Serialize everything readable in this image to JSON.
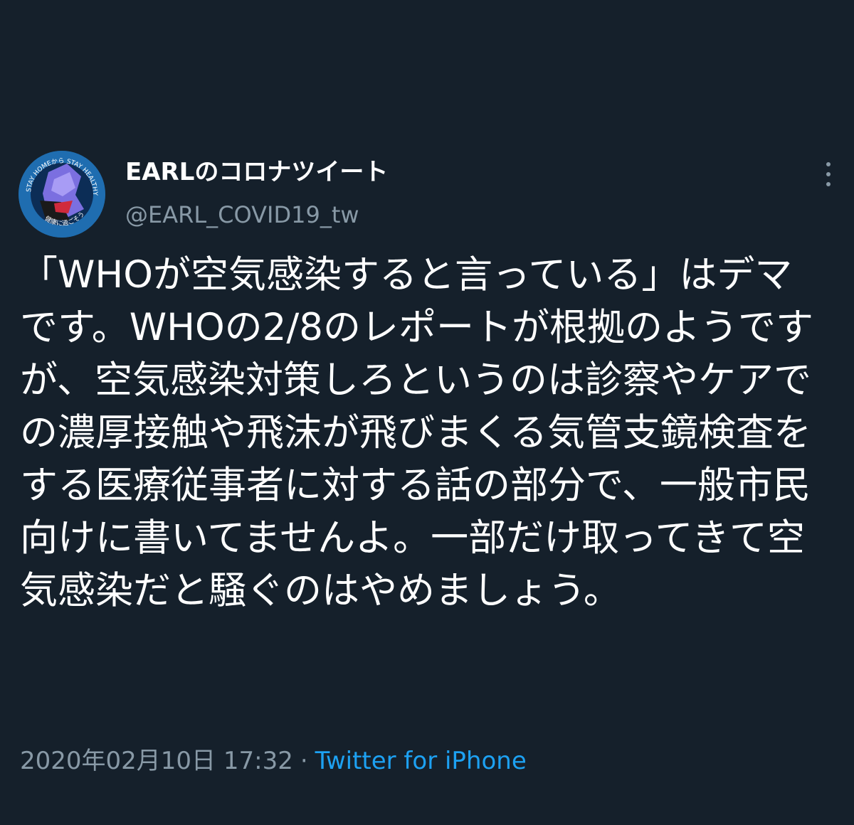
{
  "tweet": {
    "author": {
      "display_name": "EARLのコロナツイート",
      "handle": "@EARL_COVID19_tw",
      "avatar_top_text": "STAY HOMEから STAY HEALTHYへ",
      "avatar_bottom_text": "健康に過ごそう"
    },
    "text": "「WHOが空気感染すると言っている」はデマです。WHOの2/8のレポートが根拠のようですが、空気感染対策しろというのは診察やケアでの濃厚接触や飛沫が飛びまくる気管支鏡検査をする医療従事者に対する話の部分で、一般市民向けに書いてませんよ。一部だけ取ってきて空気感染だと騒ぐのはやめましょう。",
    "timestamp": "2020年02月10日 17:32",
    "separator": "·",
    "source": "Twitter for iPhone",
    "more_icon": "more-vertical-icon"
  },
  "colors": {
    "background": "#15202b",
    "text_primary": "#ffffff",
    "text_secondary": "#8899a6",
    "link": "#1da1f2"
  }
}
